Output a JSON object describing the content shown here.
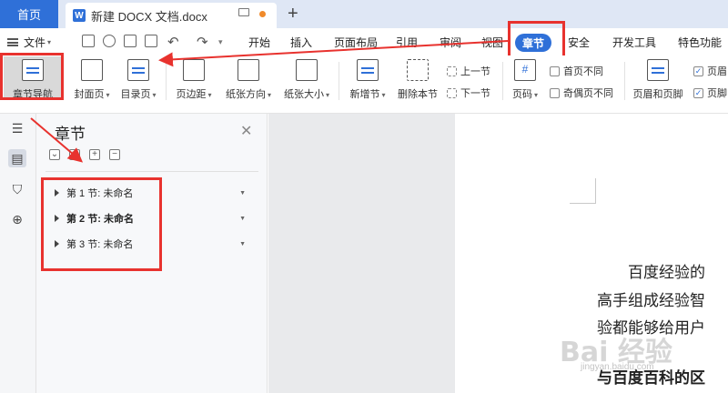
{
  "tabbar": {
    "home_label": "首页",
    "doc_label": "新建 DOCX 文档.docx",
    "new_tab": "+"
  },
  "menu": {
    "file_label": "文件",
    "tabs": [
      "开始",
      "插入",
      "页面布局",
      "引用",
      "审阅",
      "视图",
      "章节",
      "安全",
      "开发工具",
      "特色功能"
    ],
    "active_tab": "章节"
  },
  "ribbon": {
    "nav": "章节导航",
    "cover": "封面页",
    "toc": "目录页",
    "margin": "页边距",
    "orientation": "纸张方向",
    "size": "纸张大小",
    "add_section": "新增节",
    "delete_section": "删除本节",
    "prev_section": "上一节",
    "next_section": "下一节",
    "page_num": "页码",
    "first_diff": "首页不同",
    "odd_even_diff": "奇偶页不同",
    "header_footer": "页眉和页脚",
    "header_check": "页眉",
    "footer_check": "页脚"
  },
  "panel": {
    "title": "章节",
    "sections": [
      "第 1 节: 未命名",
      "第 2 节: 未命名",
      "第 3 节: 未命名"
    ]
  },
  "doc": {
    "line1": "百度经验的",
    "line2": "高手组成经验智",
    "line3": "验都能够给用户",
    "line4": "与百度百科的区",
    "watermark": "Bai 经验",
    "watermark_sub": "jingyan.baidu.com"
  },
  "colors": {
    "accent": "#2f70d8",
    "highlight": "#e8322e"
  }
}
